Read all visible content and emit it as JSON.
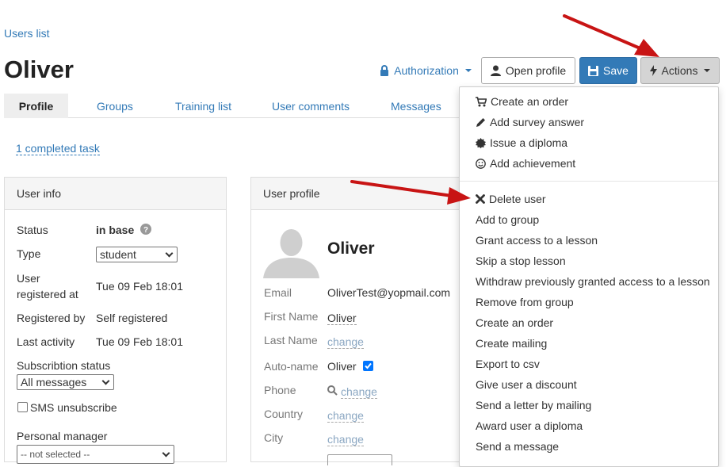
{
  "breadcrumb": "Users list",
  "page_title": "Oliver",
  "toolbar": {
    "authorization": "Authorization",
    "open_profile": "Open profile",
    "save": "Save",
    "actions": "Actions"
  },
  "tabs": [
    "Profile",
    "Groups",
    "Training list",
    "User comments",
    "Messages"
  ],
  "completed_task": "1 completed task",
  "user_info": {
    "title": "User info",
    "status_label": "Status",
    "status_value": "in base",
    "type_label": "Type",
    "type_value": "student",
    "registered_label_1": "User",
    "registered_label_2": "registered at",
    "registered_value": "Tue 09 Feb 18:01",
    "registered_by_label": "Registered by",
    "registered_by_value": "Self registered",
    "last_activity_label": "Last activity",
    "last_activity_value": "Tue 09 Feb 18:01",
    "subscription_label": "Subscribtion status",
    "subscription_value": "All messages",
    "sms_label": "SMS unsubscribe",
    "manager_label": "Personal manager",
    "manager_value": "-- not selected --"
  },
  "user_profile": {
    "title": "User profile",
    "name": "Oliver",
    "email_label": "Email",
    "email_value": "OliverTest@yopmail.com",
    "first_name_label": "First Name",
    "first_name_value": "Oliver",
    "last_name_label": "Last Name",
    "change": "change",
    "autoname_label": "Auto-name",
    "autoname_value": "Oliver",
    "phone_label": "Phone",
    "country_label": "Country",
    "city_label": "City"
  },
  "actions_menu": {
    "top_items": [
      {
        "label": "Create an order",
        "icon": "cart-icon"
      },
      {
        "label": "Add survey answer",
        "icon": "pencil-icon"
      },
      {
        "label": "Issue a diploma",
        "icon": "certificate-icon"
      },
      {
        "label": "Add achievement",
        "icon": "smile-icon"
      }
    ],
    "items": [
      "Delete user",
      "Add to group",
      "Grant access to a lesson",
      "Skip a stop lesson",
      "Withdraw previously granted access to a lesson",
      "Remove from group",
      "Create an order",
      "Create mailing",
      "Export to csv",
      "Give user a discount",
      "Send a letter by mailing",
      "Award user a diploma",
      "Send a message"
    ]
  },
  "colors": {
    "link": "#337ab7",
    "save_button": "#337ab7",
    "annotation_arrow": "#c81414"
  }
}
